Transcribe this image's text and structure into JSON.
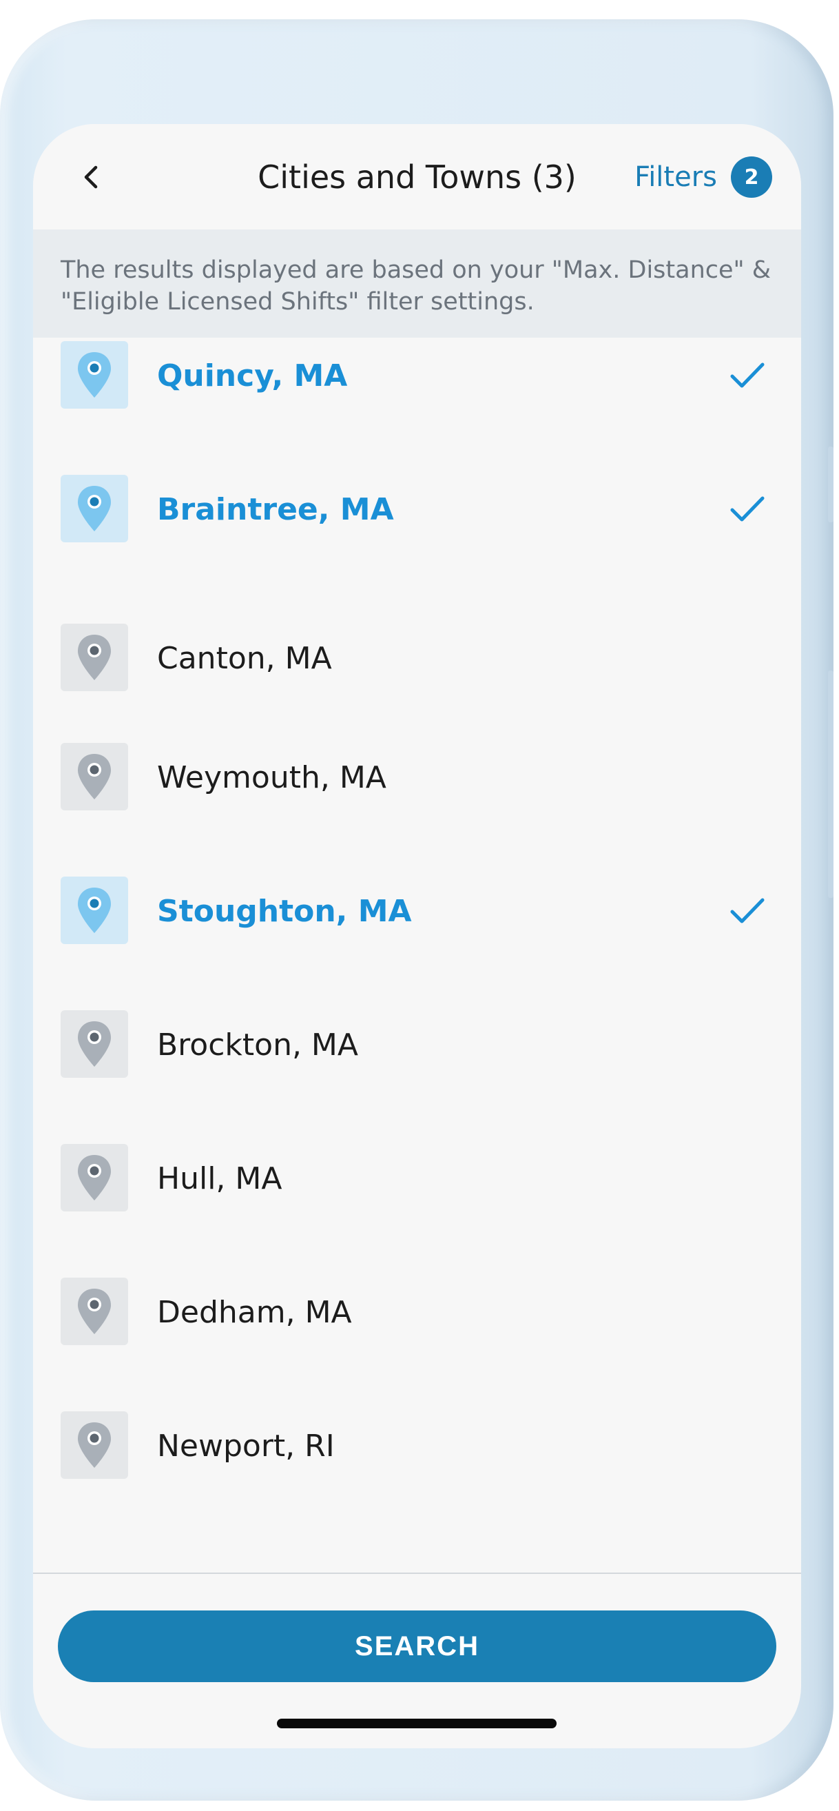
{
  "nav": {
    "back_icon": "chevron-left-icon",
    "title": "Cities and Towns (3)",
    "filters_label": "Filters",
    "filters_count": "2"
  },
  "info_banner": {
    "text": "The results displayed are based on your \"Max. Distance\" & \"Eligible Licensed Shifts\" filter settings."
  },
  "cities": [
    {
      "label": "Quincy, MA",
      "selected": true
    },
    {
      "label": "Braintree, MA",
      "selected": true
    },
    {
      "label": "Canton, MA",
      "selected": false
    },
    {
      "label": "Weymouth, MA",
      "selected": false
    },
    {
      "label": "Stoughton, MA",
      "selected": true
    },
    {
      "label": "Brockton, MA",
      "selected": false
    },
    {
      "label": "Hull, MA",
      "selected": false
    },
    {
      "label": "Dedham, MA",
      "selected": false
    },
    {
      "label": "Newport, RI",
      "selected": false
    }
  ],
  "footer": {
    "search_label": "SEARCH"
  },
  "colors": {
    "accent": "#1a80b4",
    "selected_text": "#1a8fd6",
    "selected_pin": "#7cc6ef",
    "unselected_pin": "#a9b0b8"
  },
  "icons": {
    "pin": "map-pin-icon",
    "check": "checkmark-icon"
  }
}
